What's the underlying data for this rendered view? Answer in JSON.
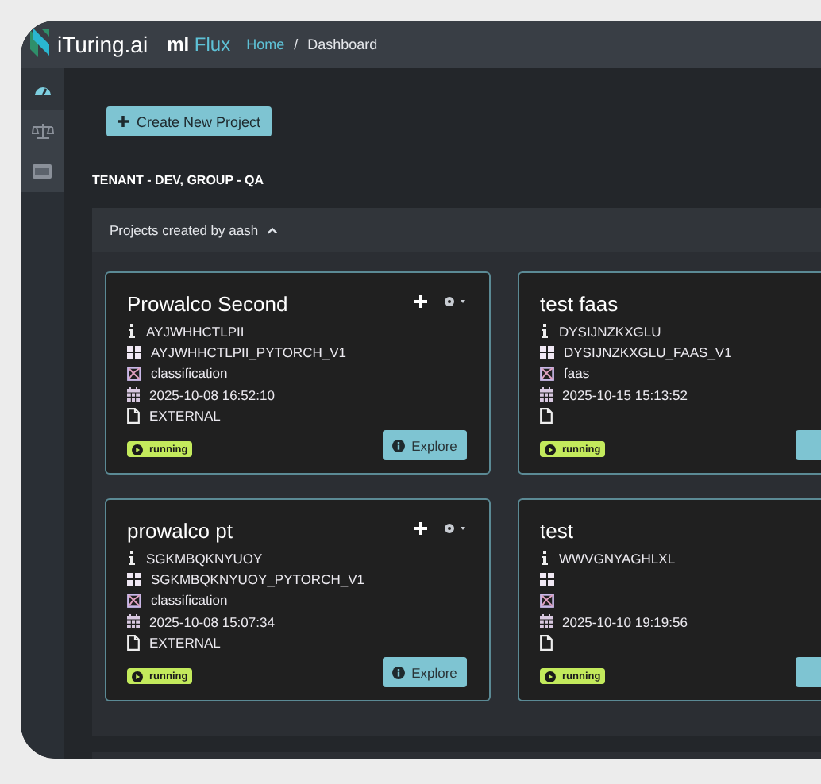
{
  "header": {
    "brand": "iTuring.ai",
    "product_prefix": "ml",
    "product_name": "Flux",
    "breadcrumb_separator": "/",
    "breadcrumb": [
      {
        "label": "Home",
        "link": true
      },
      {
        "label": "Dashboard",
        "link": false
      }
    ]
  },
  "sidebar": {
    "items": [
      {
        "kind": "dashboard",
        "selected": true
      },
      {
        "kind": "scale",
        "selected": false
      },
      {
        "kind": "card",
        "selected": false
      }
    ]
  },
  "create_button": {
    "label": "Create New Project"
  },
  "tenant_label": "TENANT - DEV, GROUP - QA",
  "panel": {
    "title": "Projects created by aash",
    "expanded": true
  },
  "cards": [
    {
      "title": "Prowalco Second",
      "id": "AYJWHHCTLPII",
      "model": "AYJWHHCTLPII_PYTORCH_V1",
      "type": "classification",
      "date": "2025-10-08 16:52:10",
      "source": "EXTERNAL",
      "status": "running",
      "explore": "Explore",
      "actions": true
    },
    {
      "title": "test faas",
      "id": "DYSIJNZKXGLU",
      "model": "DYSIJNZKXGLU_FAAS_V1",
      "type": "faas",
      "date": "2025-10-15 15:13:52",
      "status": "running",
      "actions": false
    },
    {
      "title": "prowalco pt",
      "id": "SGKMBQKNYUOY",
      "model": "SGKMBQKNYUOY_PYTORCH_V1",
      "type": "classification",
      "date": "2025-10-08 15:07:34",
      "source": "EXTERNAL",
      "status": "running",
      "explore": "Explore",
      "actions": true
    },
    {
      "title": "test",
      "id": "WWVGNYAGHLXL",
      "date": "2025-10-10 19:19:56",
      "status": "running",
      "actions": false
    }
  ]
}
